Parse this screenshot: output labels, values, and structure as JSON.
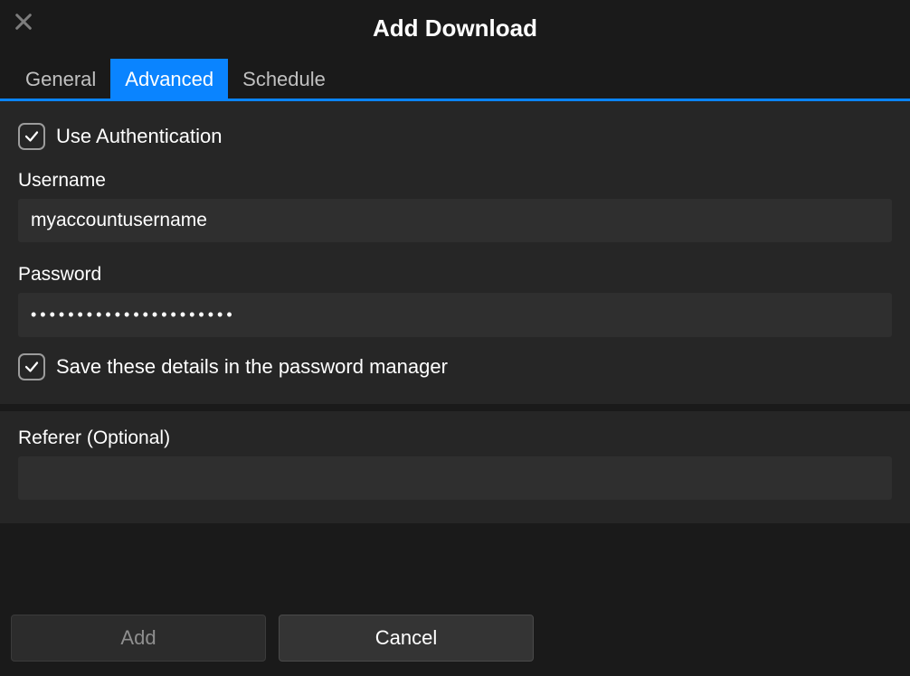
{
  "title": "Add Download",
  "tabs": {
    "general": "General",
    "advanced": "Advanced",
    "schedule": "Schedule",
    "active": "advanced"
  },
  "auth": {
    "use_label": "Use Authentication",
    "use_checked": true,
    "username_label": "Username",
    "username_value": "myaccountusername",
    "password_label": "Password",
    "password_value": "••••••••••••••••••••••",
    "save_label": "Save these details in the password manager",
    "save_checked": true
  },
  "referer": {
    "label": "Referer (Optional)",
    "value": ""
  },
  "buttons": {
    "add": "Add",
    "cancel": "Cancel",
    "add_enabled": false
  }
}
